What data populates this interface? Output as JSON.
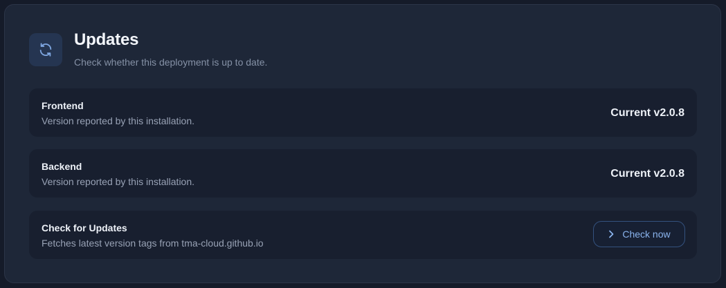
{
  "header": {
    "icon": "refresh-icon",
    "title": "Updates",
    "subtitle": "Check whether this deployment is up to date."
  },
  "rows": [
    {
      "title": "Frontend",
      "description": "Version reported by this installation.",
      "value": "Current v2.0.8"
    },
    {
      "title": "Backend",
      "description": "Version reported by this installation.",
      "value": "Current v2.0.8"
    },
    {
      "title": "Check for Updates",
      "description": "Fetches latest version tags from tma-cloud.github.io",
      "button_label": "Check now",
      "button_icon": "chevron-right-icon"
    }
  ],
  "colors": {
    "background": "#151b29",
    "card": "#1e2738",
    "row": "#181f2f",
    "accent": "#8ab4ee"
  }
}
